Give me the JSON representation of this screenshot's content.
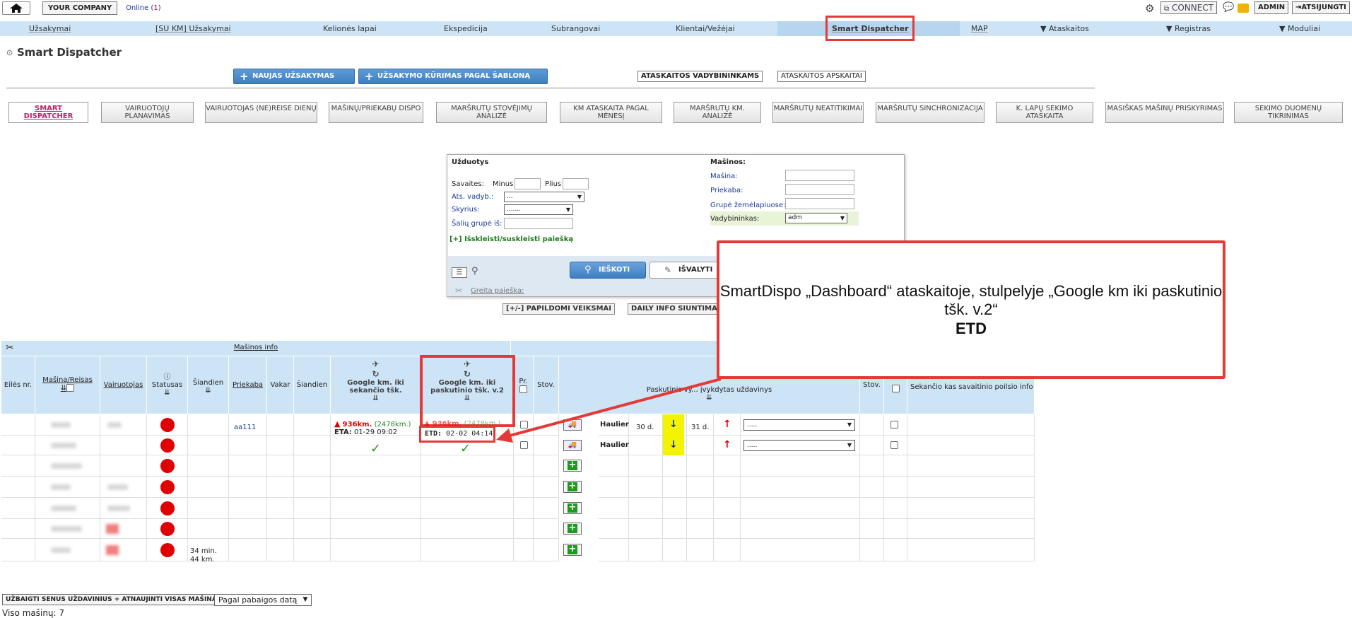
{
  "topbar": {
    "company": "YOUR COMPANY",
    "online_label": "Online (",
    "online_count": "1",
    "online_close": ")",
    "connect": "CONNECT",
    "admin": "ADMIN",
    "logout": "ATSIJUNGTI"
  },
  "nav": {
    "items": [
      "Užsakymai",
      "[SU KM] Užsakymai",
      "Kelionės lapai",
      "Ekspedicija",
      "Subrangovai",
      "Klientai/Vežėjai",
      "Smart Dispatcher",
      "MAP",
      "▼ Ataskaitos",
      "▼ Registras",
      "▼ Moduliai"
    ]
  },
  "page": {
    "title": "Smart Dispatcher",
    "btn_new_order": "NAUJAS UŽSAKYMAS",
    "btn_template": "UŽSAKYMO KŪRIMAS PAGAL ŠABLONĄ",
    "btn_reports_managers": "ATASKAITOS VADYBININKAMS",
    "btn_reports_accounting": "ATASKAITOS APSKAITAI"
  },
  "tabs": [
    "SMART DISPATCHER",
    "VAIRUOTOJŲ PLANAVIMAS",
    "VAIRUOTOJAS (NE)REISE DIENŲ",
    "MAŠINŲ/PRIEKABŲ DISPO",
    "MARŠRUTŲ STOVĖJIMŲ ANALIZĖ",
    "KM ATASKAITA PAGAL MĖNESĮ",
    "MARŠRUTŲ KM. ANALIZĖ",
    "MARŠRUTŲ NEATITIKIMAI",
    "MARŠRUTŲ SINCHRONIZACIJA",
    "K. LAPŲ SEKIMO ATASKAITA",
    "MASIŠKAS MAŠINŲ PRISKYRIMAS",
    "SEKIMO DUOMENŲ TIKRINIMAS"
  ],
  "search": {
    "tasks_title": "Užduotys",
    "weeks": "Savaites:",
    "minus": "Minus",
    "plus": "Plius",
    "resp_manager": "Ats. vadyb.:",
    "resp_manager_value": "...",
    "department": "Skyrius:",
    "department_value": ".......",
    "country_group": "Šalių grupė iš:",
    "expand": "[+] Išskleisti/suskleisti paiešką",
    "machines_title": "Mašinos:",
    "machine": "Mašina:",
    "trailer": "Priekaba:",
    "map_group": "Grupė žemėlapiuose:",
    "manager": "Vadybininkas:",
    "manager_value": "adm",
    "search_btn": "IEŠKOTI",
    "clear_btn": "IŠVALYTI",
    "quick_search": "Greita paieška:",
    "extra_actions": "[+/-] PAPILDOMI VEIKSMAI",
    "daily_info": "DAILY INFO SIUNTIMA"
  },
  "callout": {
    "text": "SmartDispo „Dashboard“ ataskaitoje, stulpelyje „Google km iki paskutinio tšk. v.2“",
    "bold": "ETD"
  },
  "table": {
    "group_header": "Mašinos info",
    "headers": {
      "row_no": "Eilės nr.",
      "vehicle_trip": "Mašina/Reisas",
      "driver": "Vairuotojas",
      "status": "Statusas",
      "today": "Šiandien",
      "trailer": "Priekaba",
      "yesterday": "Vakar",
      "today2": "Šiandien",
      "google_next": "Google km. iki sekančio tšk.",
      "google_last": "Google km. iki paskutinio tšk. v.2",
      "pr": "Pr.",
      "stov": "Stov.",
      "last_task": "Paskutinis vy... įvykdytas uždavinys",
      "stov2": "Stov.",
      "next_rest": "Sekančio kas savaitinio poilsio info"
    },
    "row1": {
      "trailer": "aa111",
      "next_km": "936km.",
      "next_km2": "(2478km.)",
      "eta_label": "ETA:",
      "eta": "01-29 09:02",
      "last_km": "936km.",
      "last_km2": "(2478km.)",
      "etd_label": "ETD:",
      "etd": "02-02 04:14",
      "haulier": "Haulier",
      "days": "30 d.",
      "days2": "31 d.",
      "select": "....."
    },
    "row2": {
      "haulier": "Haulier",
      "select": "....."
    },
    "row7": {
      "today_line1": "34 min.",
      "today_line2": "44 km."
    }
  },
  "bottom": {
    "finish_btn": "UŽBAIGTI SENUS UŽDAVINIUS + ATNAUJINTI VISAS MAŠINAS",
    "sort_select": "Pagal pabaigos datą",
    "total": "Viso mašinų: 7"
  },
  "colors": {
    "nav_bg": "#cde4f6",
    "accent_red": "#e53935",
    "blue_btn": "#3f7fc0",
    "status_red": "#e00000"
  }
}
